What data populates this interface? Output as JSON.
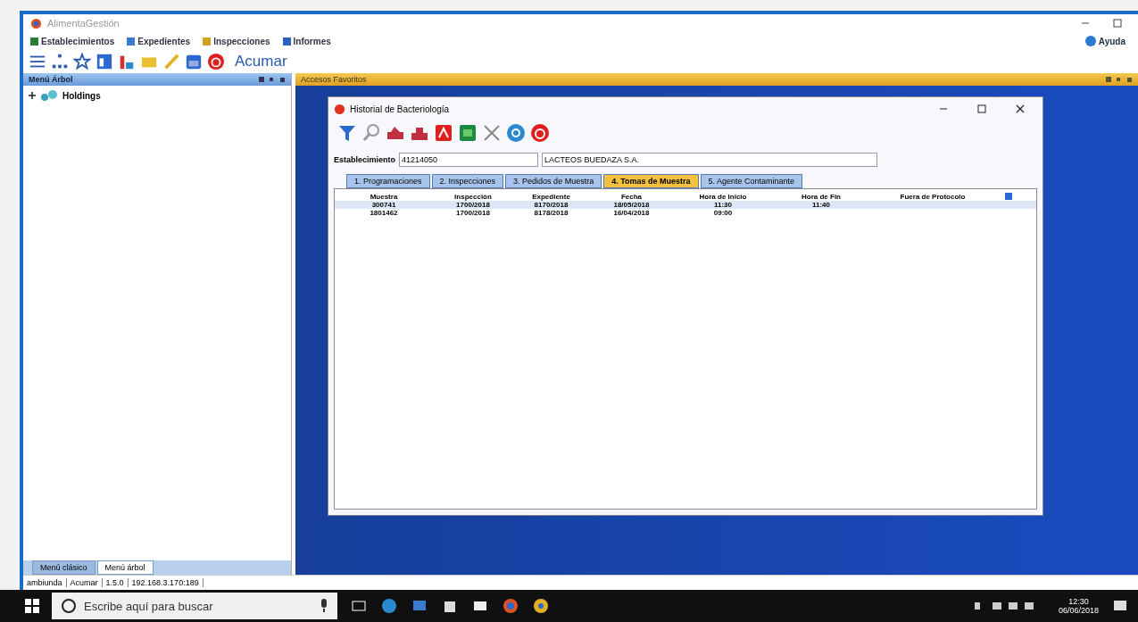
{
  "window": {
    "title": "AlimentaGestión",
    "help": "Ayuda"
  },
  "menu": [
    {
      "label": "Establecimientos",
      "color": "#2a7a3a"
    },
    {
      "label": "Expedientes",
      "color": "#3a7ad0"
    },
    {
      "label": "Inspecciones",
      "color": "#d0a020"
    },
    {
      "label": "Informes",
      "color": "#2a60c0"
    }
  ],
  "toolbar": {
    "label": "Acumar"
  },
  "tree_panel": {
    "title": "Menú Árbol",
    "items": [
      {
        "label": "Holdings",
        "expanded": false
      }
    ],
    "tabs": [
      {
        "label": "Menú clásico",
        "selected": false
      },
      {
        "label": "Menú árbol",
        "selected": true
      }
    ]
  },
  "mdi_bar": {
    "title": "Accesos Favoritos"
  },
  "dialog": {
    "title": "Historial de Bacteriología",
    "establishment": {
      "label": "Establecimiento",
      "code": "41214050",
      "name": "LACTEOS BUEDAZA S.A."
    },
    "tabs": [
      {
        "label": "1. Programaciones",
        "selected": false
      },
      {
        "label": "2. Inspecciones",
        "selected": false
      },
      {
        "label": "3. Pedidos de Muestra",
        "selected": false
      },
      {
        "label": "4. Tomas de Muestra",
        "selected": true
      },
      {
        "label": "5. Agente Contaminante",
        "selected": false
      }
    ],
    "table": {
      "columns": [
        "Muestra",
        "Inspección",
        "Expediente",
        "Fecha",
        "Hora de Inicio",
        "Hora de Fin",
        "Fuera de Protocolo"
      ],
      "rows": [
        {
          "cells": [
            "300741",
            "1700/2018",
            "8170/2018",
            "18/05/2018",
            "11:30",
            "11:40",
            ""
          ],
          "selected": true
        },
        {
          "cells": [
            "1801462",
            "1700/2018",
            "8178/2018",
            "16/04/2018",
            "09:00",
            "",
            ""
          ],
          "selected": false
        }
      ]
    }
  },
  "status_bar": [
    "ambiunda",
    "Acumar",
    "1.5.0",
    "192.168.3.170:189"
  ],
  "taskbar": {
    "search_placeholder": "Escribe aquí para buscar",
    "time": "12:30",
    "date": "06/06/2018"
  }
}
